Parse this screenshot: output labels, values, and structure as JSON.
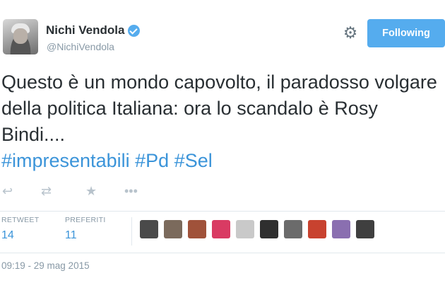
{
  "user": {
    "name": "Nichi Vendola",
    "handle": "@NichiVendola",
    "verified": true,
    "follow_label": "Following"
  },
  "tweet": {
    "text": "Questo è un mondo capovolto, il paradosso volgare della politica Italiana: ora lo scandalo è Rosy Bindi....",
    "hashtags": [
      "#impresentabili",
      "#Pd",
      "#Sel"
    ]
  },
  "actions": [
    "reply-icon",
    "retweet-icon",
    "favorite-icon",
    "more-icon"
  ],
  "stats": {
    "retweet_label": "RETWEET",
    "retweet_count": "14",
    "favorites_label": "PREFERITI",
    "favorites_count": "11"
  },
  "favoriters": [
    {
      "color": "#4a4a4a"
    },
    {
      "color": "#7b6a5c"
    },
    {
      "color": "#a0523a"
    },
    {
      "color": "#d93b63"
    },
    {
      "color": "#c9c9c9"
    },
    {
      "color": "#2f2f2f"
    },
    {
      "color": "#6b6b6b"
    },
    {
      "color": "#c8422f"
    },
    {
      "color": "#8a6fb0"
    },
    {
      "color": "#3f3f3f"
    }
  ],
  "timestamp": "09:19 - 29 mag 2015",
  "colors": {
    "accent": "#55acee",
    "link": "#3b94d9",
    "muted": "#8899a6"
  }
}
